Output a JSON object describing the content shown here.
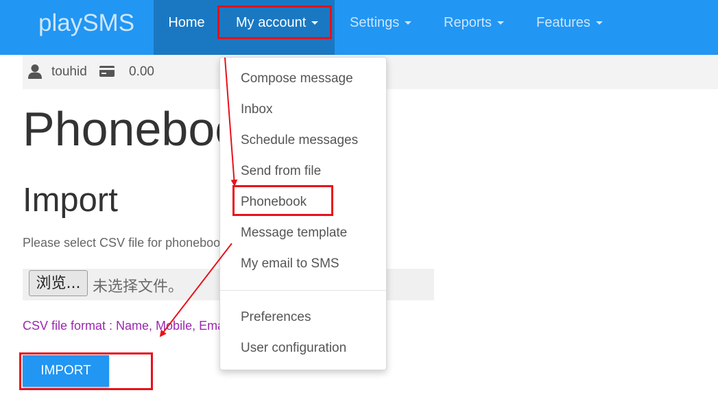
{
  "navbar": {
    "brand": "playSMS",
    "items": [
      {
        "label": "Home"
      },
      {
        "label": "My account"
      },
      {
        "label": "Settings"
      },
      {
        "label": "Reports"
      },
      {
        "label": "Features"
      }
    ]
  },
  "userbar": {
    "username": "touhid",
    "credit": "0.00"
  },
  "main": {
    "page_title": "Phonebook",
    "section_title": "Import",
    "help_text": "Please select CSV file for phonebook entries",
    "browse_label": "浏览...",
    "no_file_text": "未选择文件。",
    "format_text": "CSV file format : Name, Mobile, Email, Group code",
    "import_label": "IMPORT"
  },
  "dropdown": {
    "items": [
      {
        "label": "Compose message"
      },
      {
        "label": "Inbox"
      },
      {
        "label": "Schedule messages"
      },
      {
        "label": "Send from file"
      },
      {
        "label": "Phonebook"
      },
      {
        "label": "Message template"
      },
      {
        "label": "My email to SMS"
      },
      {
        "label": "Preferences"
      },
      {
        "label": "User configuration"
      }
    ]
  },
  "colors": {
    "primary": "#2196f3",
    "primary_dark": "#1a78c2",
    "annotation_red": "#e8101a",
    "format_purple": "#9c27b0"
  }
}
